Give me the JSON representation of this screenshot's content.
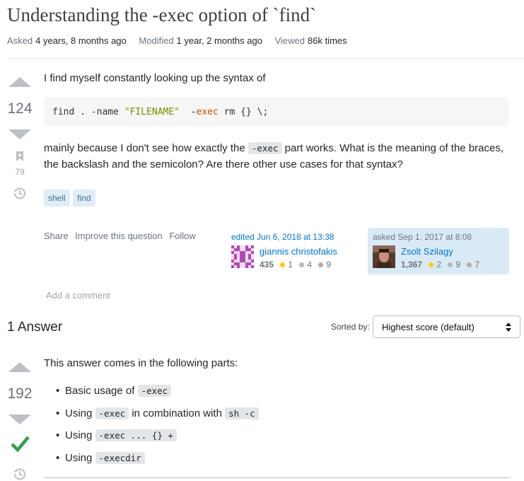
{
  "question": {
    "title": "Understanding the -exec option of `find`",
    "meta": {
      "asked_label": "Asked",
      "asked_value": "4 years, 8 months ago",
      "modified_label": "Modified",
      "modified_value": "1 year, 2 months ago",
      "viewed_label": "Viewed",
      "viewed_value": "86k times"
    },
    "score": "124",
    "bookmark_count": "79",
    "body_intro": "I find myself constantly looking up the syntax of",
    "code": {
      "part1": "find . -name ",
      "string": "\"FILENAME\"",
      "part2": "  -",
      "keyword": "exec",
      "part3": " rm {} \\;"
    },
    "body2_before": "mainly because I don't see how exactly the ",
    "body2_code": "-exec",
    "body2_after": " part works. What is the meaning of the braces, the backslash and the semicolon? Are there other use cases for that syntax?",
    "tags": [
      "shell",
      "find"
    ],
    "actions": {
      "share": "Share",
      "improve": "Improve this question",
      "follow": "Follow"
    },
    "editor": {
      "time": "edited Jun 6, 2018 at 13:38",
      "name": "giannis christofakis",
      "rep": "435",
      "gold": "1",
      "silver": "4",
      "bronze": "9"
    },
    "asker": {
      "time": "asked Sep 1, 2017 at 8:08",
      "name": "Zsolt Szilagy",
      "rep": "1,367",
      "gold": "2",
      "silver": "9",
      "bronze": "7"
    },
    "add_comment": "Add a comment"
  },
  "answers_header": {
    "count": "1",
    "label": "Answer"
  },
  "sort": {
    "label": "Sorted by:",
    "selected": "Highest score (default)"
  },
  "answer": {
    "score": "192",
    "intro": "This answer comes in the following parts:",
    "parts": [
      {
        "text": "Basic usage of ",
        "code": "-exec",
        "after": ""
      },
      {
        "text": "Using ",
        "code": "-exec",
        "after": " in combination with ",
        "code2": "sh -c"
      },
      {
        "text": "Using ",
        "code": "-exec ... {} +",
        "after": ""
      },
      {
        "text": "Using ",
        "code": "-execdir",
        "after": ""
      }
    ]
  },
  "colors": {
    "link": "#0074cc",
    "accepted": "#2f9e4e",
    "gold": "#ffcc01",
    "silver": "#b4b8bc",
    "bronze": "#d1a684"
  },
  "icons": [
    "upvote-icon",
    "downvote-icon",
    "bookmark-icon",
    "history-icon",
    "accepted-check-icon",
    "sort-chevron-icon"
  ]
}
